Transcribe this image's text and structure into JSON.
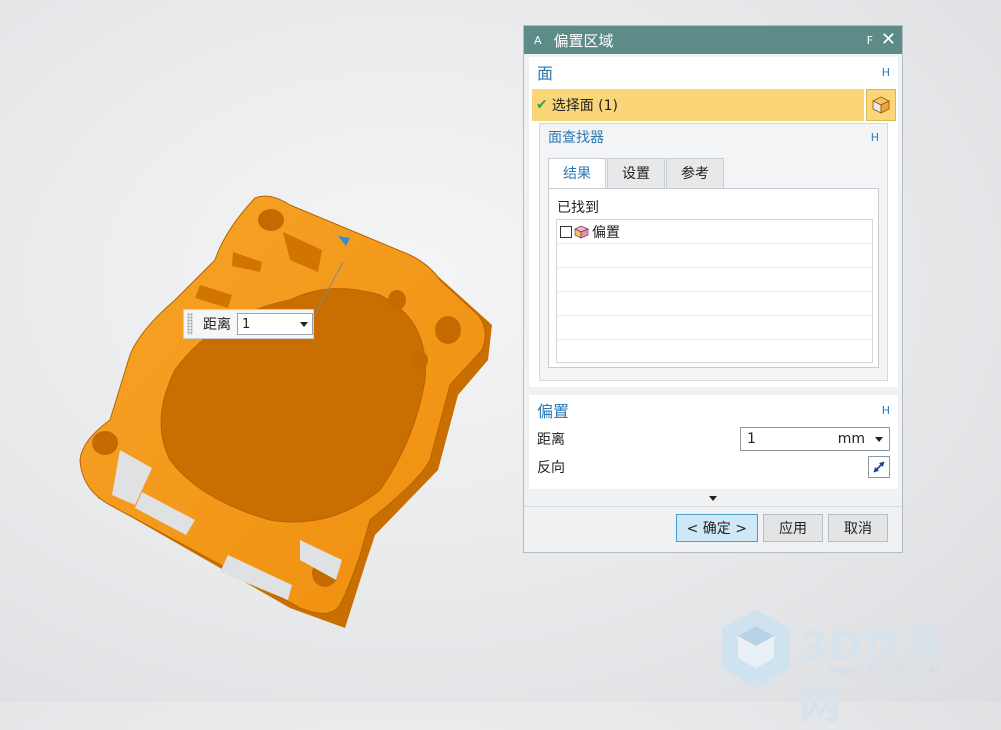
{
  "viewport": {
    "floating_input": {
      "label": "距离",
      "value": "1"
    }
  },
  "dialog": {
    "title_hint_left": "A",
    "title": "偏置区域",
    "title_hint_right": "F",
    "face_section": {
      "title": "面",
      "collapse_hint": "H",
      "select_face_label": "选择面 (1)"
    },
    "face_finder": {
      "title": "面查找器",
      "collapse_hint": "H",
      "tabs": [
        "结果",
        "设置",
        "参考"
      ],
      "active_tab": "结果",
      "found_label": "已找到",
      "items": [
        {
          "label": "偏置"
        }
      ]
    },
    "offset_section": {
      "title": "偏置",
      "collapse_hint": "H",
      "distance_label": "距离",
      "distance_value": "1",
      "distance_unit": "mm",
      "reverse_label": "反向"
    },
    "buttons": {
      "ok": "< 确定 >",
      "apply": "应用",
      "cancel": "取消"
    }
  },
  "watermark": {
    "brand": "3D世界网",
    "url": "WWW.3DSJW.COM"
  },
  "colors": {
    "title_bar": "#5d8b88",
    "selection": "#fbd679",
    "part": "#f59a17",
    "accent_text": "#2b7ab3"
  },
  "icons": [
    "checkmark-icon",
    "cube-icon",
    "close-icon",
    "reverse-direction-icon",
    "dropdown-arrow-icon"
  ]
}
